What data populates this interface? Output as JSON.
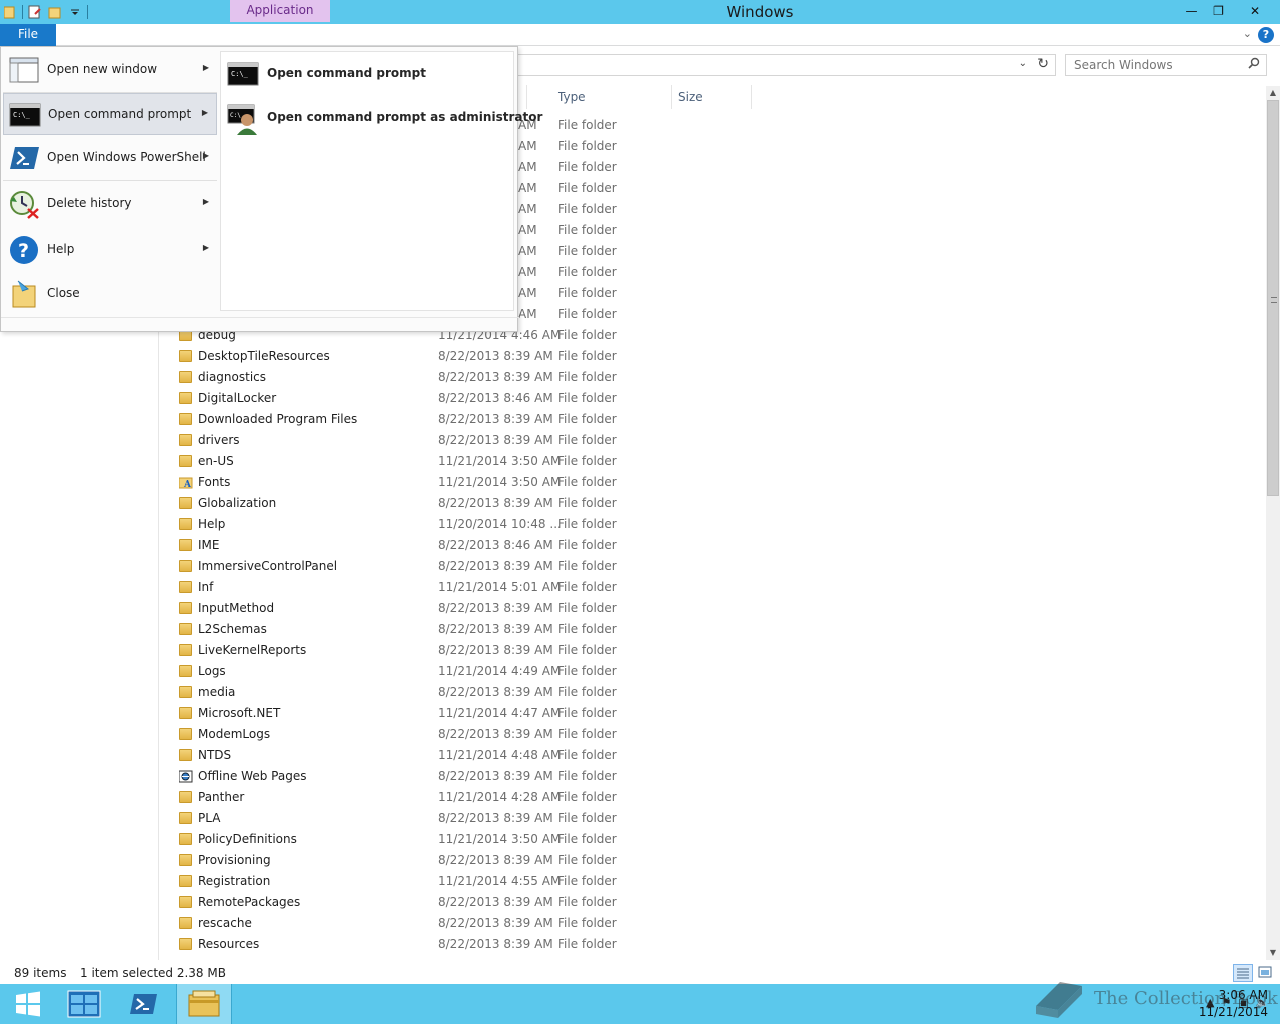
{
  "window": {
    "title": "Windows",
    "context_tab": "Application Tools",
    "minimize": "—",
    "maximize": "❐",
    "close": "✕"
  },
  "ribbon": {
    "file_tab": "File",
    "collapse_chevron": "⌄",
    "help": "?"
  },
  "address": {
    "dropdown": "⌄",
    "refresh": "↻"
  },
  "search": {
    "placeholder": "Search Windows",
    "icon": "search-icon"
  },
  "columns": {
    "type": "Type",
    "size": "Size"
  },
  "file_menu": {
    "items": [
      {
        "label": "Open new window",
        "icon": "window-icon",
        "arrow": "▶"
      },
      {
        "label": "Open command prompt",
        "icon": "cmd-icon",
        "arrow": "▶"
      },
      {
        "label": "Open Windows PowerShell",
        "icon": "powershell-icon",
        "arrow": "▶"
      },
      {
        "label": "Delete history",
        "icon": "delete-history-icon",
        "arrow": "▶"
      },
      {
        "label": "Help",
        "icon": "help-icon",
        "arrow": "▶"
      },
      {
        "label": "Close",
        "icon": "close-folder-icon"
      }
    ],
    "submenu": [
      {
        "label": "Open command prompt",
        "icon": "cmd-icon"
      },
      {
        "label": "Open command prompt as administrator",
        "icon": "cmd-admin-icon"
      }
    ]
  },
  "files": {
    "hidden_rows": [
      {
        "date": "AM",
        "type": "File folder"
      },
      {
        "date": "AM",
        "type": "File folder"
      },
      {
        "date": "AM",
        "type": "File folder"
      },
      {
        "date": "AM",
        "type": "File folder"
      },
      {
        "date": "AM",
        "type": "File folder"
      },
      {
        "date": "AM",
        "type": "File folder"
      },
      {
        "date": "AM",
        "type": "File folder"
      },
      {
        "date": "AM",
        "type": "File folder"
      },
      {
        "date": "AM",
        "type": "File folder"
      },
      {
        "date": "AM",
        "type": "File folder"
      }
    ],
    "rows": [
      {
        "name": "debug",
        "date": "11/21/2014 4:46 AM",
        "type": "File folder",
        "icon": "folder"
      },
      {
        "name": "DesktopTileResources",
        "date": "8/22/2013 8:39 AM",
        "type": "File folder",
        "icon": "folder"
      },
      {
        "name": "diagnostics",
        "date": "8/22/2013 8:39 AM",
        "type": "File folder",
        "icon": "folder"
      },
      {
        "name": "DigitalLocker",
        "date": "8/22/2013 8:46 AM",
        "type": "File folder",
        "icon": "folder"
      },
      {
        "name": "Downloaded Program Files",
        "date": "8/22/2013 8:39 AM",
        "type": "File folder",
        "icon": "folder"
      },
      {
        "name": "drivers",
        "date": "8/22/2013 8:39 AM",
        "type": "File folder",
        "icon": "folder"
      },
      {
        "name": "en-US",
        "date": "11/21/2014 3:50 AM",
        "type": "File folder",
        "icon": "folder"
      },
      {
        "name": "Fonts",
        "date": "11/21/2014 3:50 AM",
        "type": "File folder",
        "icon": "fonts"
      },
      {
        "name": "Globalization",
        "date": "8/22/2013 8:39 AM",
        "type": "File folder",
        "icon": "folder"
      },
      {
        "name": "Help",
        "date": "11/20/2014 10:48 ...",
        "type": "File folder",
        "icon": "folder"
      },
      {
        "name": "IME",
        "date": "8/22/2013 8:46 AM",
        "type": "File folder",
        "icon": "folder"
      },
      {
        "name": "ImmersiveControlPanel",
        "date": "8/22/2013 8:39 AM",
        "type": "File folder",
        "icon": "folder"
      },
      {
        "name": "Inf",
        "date": "11/21/2014 5:01 AM",
        "type": "File folder",
        "icon": "folder"
      },
      {
        "name": "InputMethod",
        "date": "8/22/2013 8:39 AM",
        "type": "File folder",
        "icon": "folder"
      },
      {
        "name": "L2Schemas",
        "date": "8/22/2013 8:39 AM",
        "type": "File folder",
        "icon": "folder"
      },
      {
        "name": "LiveKernelReports",
        "date": "8/22/2013 8:39 AM",
        "type": "File folder",
        "icon": "folder"
      },
      {
        "name": "Logs",
        "date": "11/21/2014 4:49 AM",
        "type": "File folder",
        "icon": "folder"
      },
      {
        "name": "media",
        "date": "8/22/2013 8:39 AM",
        "type": "File folder",
        "icon": "folder"
      },
      {
        "name": "Microsoft.NET",
        "date": "11/21/2014 4:47 AM",
        "type": "File folder",
        "icon": "folder"
      },
      {
        "name": "ModemLogs",
        "date": "8/22/2013 8:39 AM",
        "type": "File folder",
        "icon": "folder"
      },
      {
        "name": "NTDS",
        "date": "11/21/2014 4:48 AM",
        "type": "File folder",
        "icon": "folder"
      },
      {
        "name": "Offline Web Pages",
        "date": "8/22/2013 8:39 AM",
        "type": "File folder",
        "icon": "offline"
      },
      {
        "name": "Panther",
        "date": "11/21/2014 4:28 AM",
        "type": "File folder",
        "icon": "folder"
      },
      {
        "name": "PLA",
        "date": "8/22/2013 8:39 AM",
        "type": "File folder",
        "icon": "folder"
      },
      {
        "name": "PolicyDefinitions",
        "date": "11/21/2014 3:50 AM",
        "type": "File folder",
        "icon": "folder"
      },
      {
        "name": "Provisioning",
        "date": "8/22/2013 8:39 AM",
        "type": "File folder",
        "icon": "folder"
      },
      {
        "name": "Registration",
        "date": "11/21/2014 4:55 AM",
        "type": "File folder",
        "icon": "folder"
      },
      {
        "name": "RemotePackages",
        "date": "8/22/2013 8:39 AM",
        "type": "File folder",
        "icon": "folder"
      },
      {
        "name": "rescache",
        "date": "8/22/2013 8:39 AM",
        "type": "File folder",
        "icon": "folder"
      },
      {
        "name": "Resources",
        "date": "8/22/2013 8:39 AM",
        "type": "File folder",
        "icon": "folder"
      }
    ]
  },
  "status": {
    "count": "89 items",
    "selection": "1 item selected  2.38 MB"
  },
  "taskbar": {
    "time": "3:06 AM",
    "date": "11/21/2014",
    "watermark": "The Collection Book"
  },
  "colors": {
    "titlebar": "#5bc8ec",
    "file_tab": "#1979ca",
    "context_tab": "#e3c3ee"
  }
}
